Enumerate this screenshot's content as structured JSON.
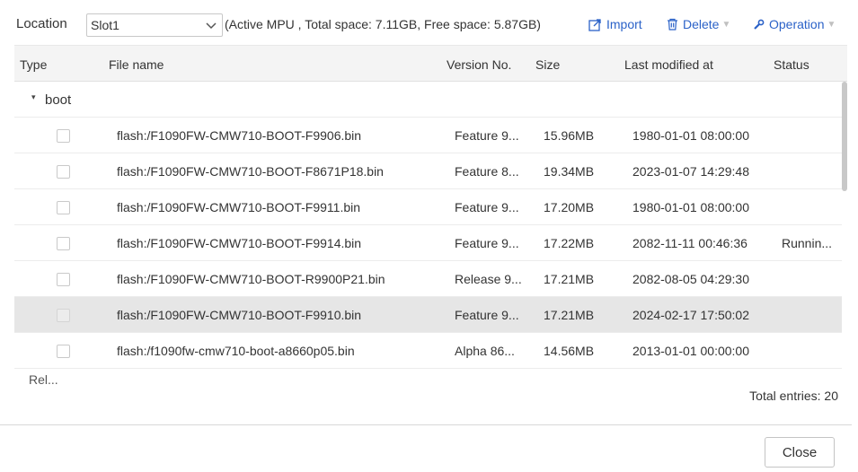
{
  "toolbar": {
    "location_label": "Location",
    "location_value": "Slot1",
    "space_info": "(Active MPU , Total space: 7.11GB, Free space: 5.87GB)",
    "import_label": "Import",
    "delete_label": "Delete",
    "operation_label": "Operation",
    "accent_color": "#2b62c8"
  },
  "table": {
    "columns": [
      "Type",
      "File name",
      "Version No.",
      "Size",
      "Last modified at",
      "Status"
    ],
    "group": {
      "label": "boot",
      "toggle": "▾"
    },
    "rows": [
      {
        "file": "flash:/F1090FW-CMW710-BOOT-F9906.bin",
        "version": "Feature 9...",
        "size": "15.96MB",
        "modified": "1980-01-01 08:00:00",
        "status": ""
      },
      {
        "file": "flash:/F1090FW-CMW710-BOOT-F8671P18.bin",
        "version": "Feature 8...",
        "size": "19.34MB",
        "modified": "2023-01-07 14:29:48",
        "status": ""
      },
      {
        "file": "flash:/F1090FW-CMW710-BOOT-F9911.bin",
        "version": "Feature 9...",
        "size": "17.20MB",
        "modified": "1980-01-01 08:00:00",
        "status": ""
      },
      {
        "file": "flash:/F1090FW-CMW710-BOOT-F9914.bin",
        "version": "Feature 9...",
        "size": "17.22MB",
        "modified": "2082-11-11 00:46:36",
        "status": "Runnin..."
      },
      {
        "file": "flash:/F1090FW-CMW710-BOOT-R9900P21.bin",
        "version": "Release 9...",
        "size": "17.21MB",
        "modified": "2082-08-05 04:29:30",
        "status": ""
      },
      {
        "file": "flash:/F1090FW-CMW710-BOOT-F9910.bin",
        "version": "Feature 9...",
        "size": "17.21MB",
        "modified": "2024-02-17 17:50:02",
        "status": "",
        "selected": true
      },
      {
        "file": "flash:/f1090fw-cmw710-boot-a8660p05.bin",
        "version": "Alpha 86...",
        "size": "14.56MB",
        "modified": "2013-01-01 00:00:00",
        "status": ""
      }
    ],
    "partial_row_text": "Rel..."
  },
  "footer": {
    "total_entries": "Total entries: 20",
    "close_label": "Close"
  }
}
